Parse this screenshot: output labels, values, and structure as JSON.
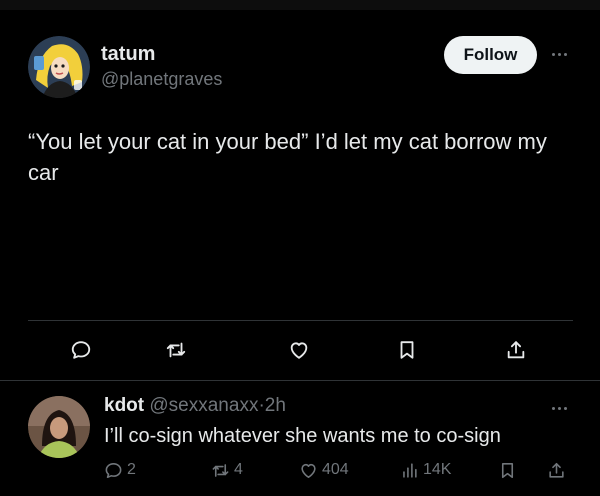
{
  "post": {
    "author_name": "tatum",
    "author_handle": "@planetgraves",
    "follow_label": "Follow",
    "text": "“You let your cat in your bed” I’d let my cat borrow my car",
    "actions": [
      "reply-icon",
      "repost-icon",
      "like-icon",
      "bookmark-icon",
      "share-icon"
    ]
  },
  "reply": {
    "author_name": "kdot",
    "author_handle": "@sexxanaxx",
    "separator": "·",
    "time": "2h",
    "text": "I’ll co-sign whatever she wants me to co-sign",
    "reply_count": "2",
    "repost_count": "4",
    "like_count": "404",
    "view_count": "14K"
  },
  "colors": {
    "background": "#000000",
    "text": "#e7e9ea",
    "muted": "#71767b",
    "divider": "#2f3336",
    "follow_bg": "#eff3f4"
  }
}
